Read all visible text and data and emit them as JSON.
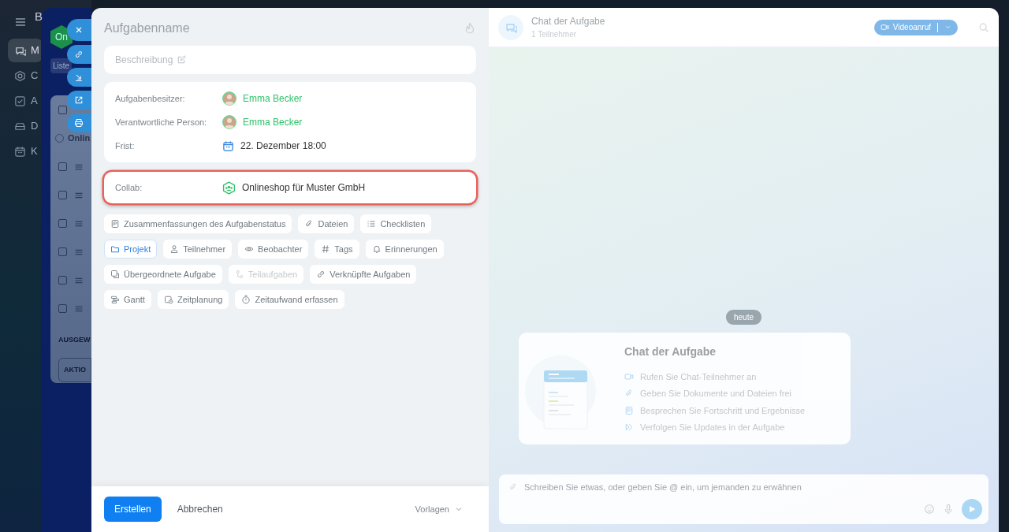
{
  "background_app": {
    "logo": "B",
    "nav": [
      {
        "label": "M",
        "selected": true
      },
      {
        "label": "C",
        "selected": false
      },
      {
        "label": "A",
        "selected": false
      },
      {
        "label": "D",
        "selected": false
      },
      {
        "label": "K",
        "selected": false
      }
    ],
    "group_badge": "On",
    "view_tab": "Liste",
    "group_label": "Onlin",
    "rows": [
      {
        "checked": false
      },
      {
        "checked": false
      },
      {
        "checked": false
      },
      {
        "checked": false
      },
      {
        "checked": false
      },
      {
        "checked": false
      },
      {
        "checked": false
      }
    ],
    "section_label": "AUSGEW",
    "action_label": "AKTIO"
  },
  "task": {
    "title_placeholder": "Aufgabenname",
    "description_placeholder": "Beschreibung",
    "fields": [
      {
        "kind": "person",
        "label": "Aufgabenbesitzer:",
        "value": "Emma Becker"
      },
      {
        "kind": "person",
        "label": "Verantwortliche Person:",
        "value": "Emma Becker"
      },
      {
        "kind": "date",
        "label": "Frist:",
        "value": "22. Dezember 18:00"
      }
    ],
    "collab": {
      "label": "Collab:",
      "value": "Onlineshop für Muster GmbH",
      "highlighted": true
    },
    "chip_rows": [
      [
        {
          "label": "Zusammenfassungen des Aufgabenstatus",
          "selected": false,
          "disabled": false
        },
        {
          "label": "Dateien",
          "selected": false,
          "disabled": false
        },
        {
          "label": "Checklisten",
          "selected": false,
          "disabled": false
        }
      ],
      [
        {
          "label": "Projekt",
          "selected": true,
          "disabled": false
        },
        {
          "label": "Teilnehmer",
          "selected": false,
          "disabled": false
        },
        {
          "label": "Beobachter",
          "selected": false,
          "disabled": false
        },
        {
          "label": "Tags",
          "selected": false,
          "disabled": false
        },
        {
          "label": "Erinnerungen",
          "selected": false,
          "disabled": false
        }
      ],
      [
        {
          "label": "Übergeordnete Aufgabe",
          "selected": false,
          "disabled": false
        },
        {
          "label": "Teilaufgaben",
          "selected": false,
          "disabled": true
        },
        {
          "label": "Verknüpfte Aufgaben",
          "selected": false,
          "disabled": false
        }
      ],
      [
        {
          "label": "Gantt",
          "selected": false,
          "disabled": false
        },
        {
          "label": "Zeitplanung",
          "selected": false,
          "disabled": false
        },
        {
          "label": "Zeitaufwand erfassen",
          "selected": false,
          "disabled": false
        }
      ]
    ],
    "footer": {
      "primary": "Erstellen",
      "cancel": "Abbrechen",
      "templates": "Vorlagen"
    }
  },
  "chat": {
    "title": "Chat der Aufgabe",
    "subtitle": "1 Teilnehmer",
    "video_button": "Videoanruf",
    "date_divider": "heute",
    "intro": {
      "title": "Chat der Aufgabe",
      "items": [
        "Rufen Sie Chat-Teilnehmer an",
        "Geben Sie Dokumente und Dateien frei",
        "Besprechen Sie Fortschritt und Ergebnisse",
        "Verfolgen Sie Updates in der Aufgabe"
      ]
    },
    "composer": {
      "placeholder": "Schreiben Sie etwas, oder geben Sie @ ein, um jemanden zu erwähnen"
    }
  }
}
